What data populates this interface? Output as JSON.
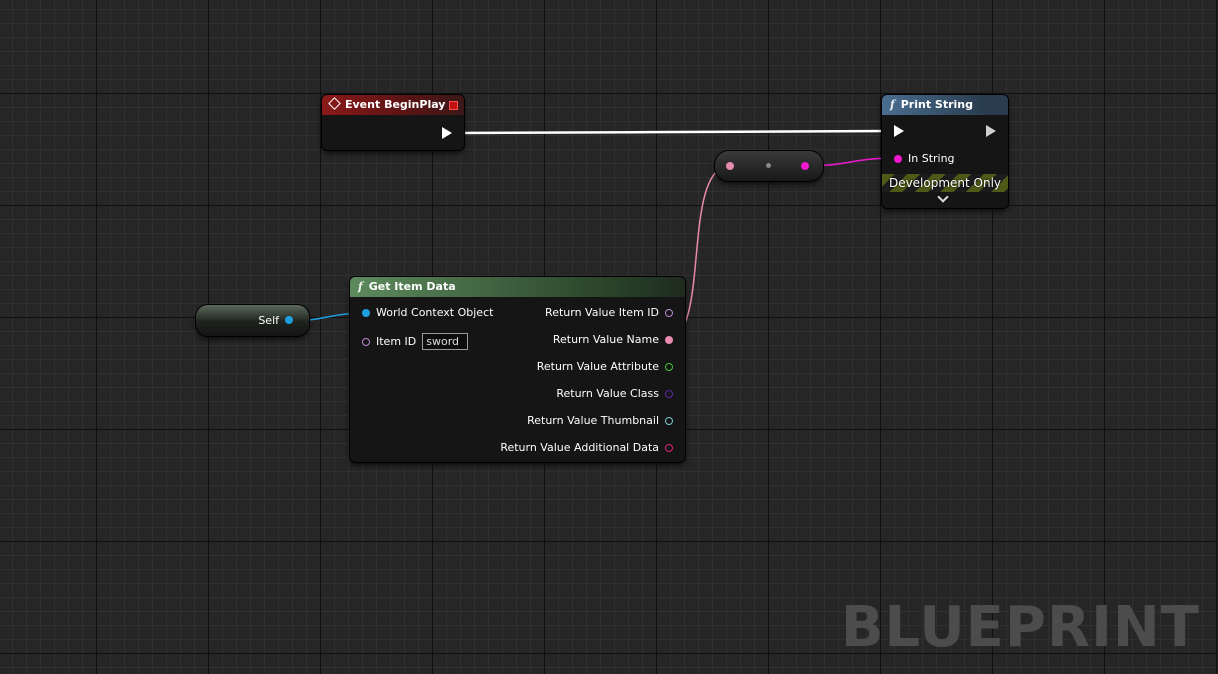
{
  "editor": {
    "watermark": "BLUEPRINT"
  },
  "nodes": {
    "begin_play": {
      "title": "Event BeginPlay"
    },
    "print_string": {
      "title": "Print String",
      "in_string_label": "In String",
      "dev_only_label": "Development Only"
    },
    "self_node": {
      "label": "Self"
    },
    "get_item_data": {
      "title": "Get Item Data",
      "world_context_label": "World Context Object",
      "item_id_label": "Item ID",
      "item_id_value": "sword",
      "outputs": [
        "Return Value Item ID",
        "Return Value Name",
        "Return Value Attribute",
        "Return Value Class",
        "Return Value Thumbnail",
        "Return Value Additional Data"
      ]
    }
  },
  "colors": {
    "exec": "#ffffff",
    "object_pin": "#1e9fe0",
    "name_pin": "#e88ab0",
    "string_pin": "#f019d0",
    "int_pin": "#b98ad6",
    "attribute_pin": "#45c238",
    "class_pin": "#5e2aa3",
    "thumbnail_pin": "#7ec8d0",
    "additional_pin": "#e0207a",
    "event_header": "#8b1a1a",
    "function_header": "#3e5a78",
    "pure_header": "#466b46"
  }
}
